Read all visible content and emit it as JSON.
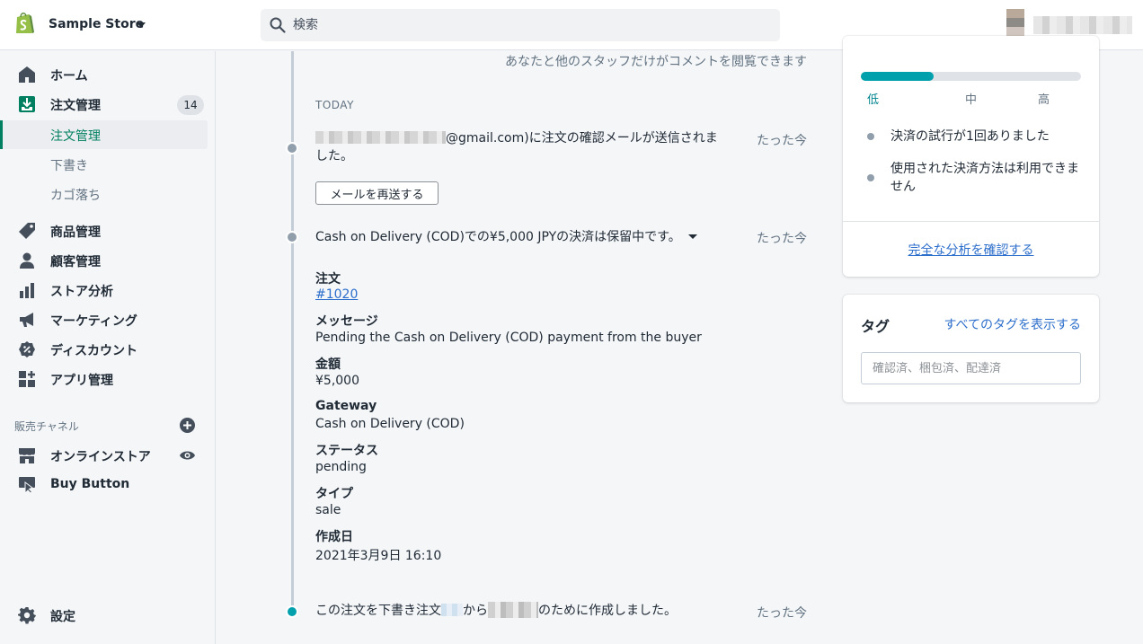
{
  "header": {
    "store_name": "Sample Store",
    "search_placeholder": "検索"
  },
  "sidebar": {
    "items": [
      {
        "label": "ホーム",
        "icon": "home-icon"
      },
      {
        "label": "注文管理",
        "icon": "orders-icon",
        "badge": "14"
      },
      {
        "label": "商品管理",
        "icon": "tag-icon"
      },
      {
        "label": "顧客管理",
        "icon": "person-icon"
      },
      {
        "label": "ストア分析",
        "icon": "bar-chart-icon"
      },
      {
        "label": "マーケティング",
        "icon": "megaphone-icon"
      },
      {
        "label": "ディスカウント",
        "icon": "discount-icon"
      },
      {
        "label": "アプリ管理",
        "icon": "apps-icon"
      }
    ],
    "sub_items": [
      "注文管理",
      "下書き",
      "カゴ落ち"
    ],
    "sales_channels_label": "販売チャネル",
    "channels": [
      {
        "label": "オンラインストア",
        "icon": "store-icon"
      },
      {
        "label": "Buy Button",
        "icon": "buy-button-icon"
      }
    ],
    "settings_label": "設定"
  },
  "timeline": {
    "comment_note": "あなたと他のスタッフだけがコメントを閲覧できます",
    "today_label": "TODAY",
    "events": [
      {
        "text_suffix": "@gmail.com)に注文の確認メールが送信されました。",
        "time": "たった今",
        "button_label": "メールを再送する"
      },
      {
        "text": "Cash on Delivery (COD)での¥5,000 JPYの決済は保留中です。",
        "time": "たった今"
      },
      {
        "text_part1": "この注文を下書き注文",
        "text_part2": "から",
        "text_part3": "のために作成しました。",
        "time": "たった今"
      }
    ],
    "details": {
      "order_label": "注文",
      "order_value": "#1020",
      "message_label": "メッセージ",
      "message_value": "Pending the Cash on Delivery (COD) payment from the buyer",
      "amount_label": "金額",
      "amount_value": "¥5,000",
      "gateway_label": "Gateway",
      "gateway_value": "Cash on Delivery (COD)",
      "status_label": "ステータス",
      "status_value": "pending",
      "type_label": "タイプ",
      "type_value": "sale",
      "created_label": "作成日",
      "created_value": "2021年3月9日 16:10"
    }
  },
  "risk": {
    "level_fraction": 0.33,
    "levels": [
      "低",
      "中",
      "高"
    ],
    "bullets": [
      "決済の試行が1回ありました",
      "使用された決済方法は利用できません"
    ],
    "link": "完全な分析を確認する"
  },
  "tags": {
    "title": "タグ",
    "link": "すべてのタグを表示する",
    "placeholder": "確認済、梱包済、配達済"
  },
  "colors": {
    "brand_green": "#008060",
    "teal": "#00a0ac",
    "link_blue": "#2c6ecb"
  }
}
